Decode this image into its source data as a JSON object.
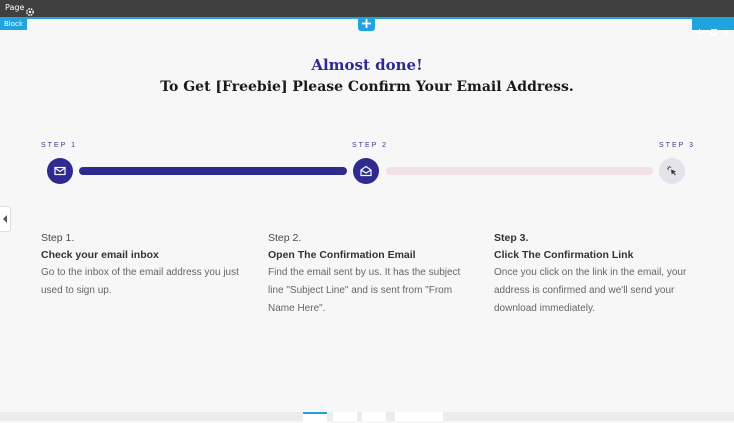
{
  "editor": {
    "page_label": "Page",
    "block_label": "Block"
  },
  "hero": {
    "title": "Almost done!",
    "subtitle": "To Get [Freebie] Please Confirm Your Email Address."
  },
  "progress": {
    "steps": [
      {
        "label": "STEP 1",
        "state": "complete",
        "icon": "mail-icon"
      },
      {
        "label": "STEP 2",
        "state": "complete",
        "icon": "open-mail-icon"
      },
      {
        "label": "STEP 3",
        "state": "pending",
        "icon": "click-icon"
      }
    ],
    "colors": {
      "active": "#2e2a8f",
      "inactive_track": "#f2e1e6",
      "inactive_circle": "#e3e3ea"
    }
  },
  "instructions": [
    {
      "number": "Step 1.",
      "title": "Check your email inbox",
      "description": "Go to the inbox of the email address you just used to sign up."
    },
    {
      "number": "Step 2.",
      "title": "Open The Confirmation Email",
      "description": "Find the email sent by us. It has the subject line \"Subject Line\" and is sent from \"From Name Here\"."
    },
    {
      "number": "Step 3.",
      "title": "Click The Confirmation Link",
      "description": "Once you click on the link in the email, your address is confirmed and we'll send your download immediately."
    }
  ],
  "accent_color": "#1fa4e0"
}
